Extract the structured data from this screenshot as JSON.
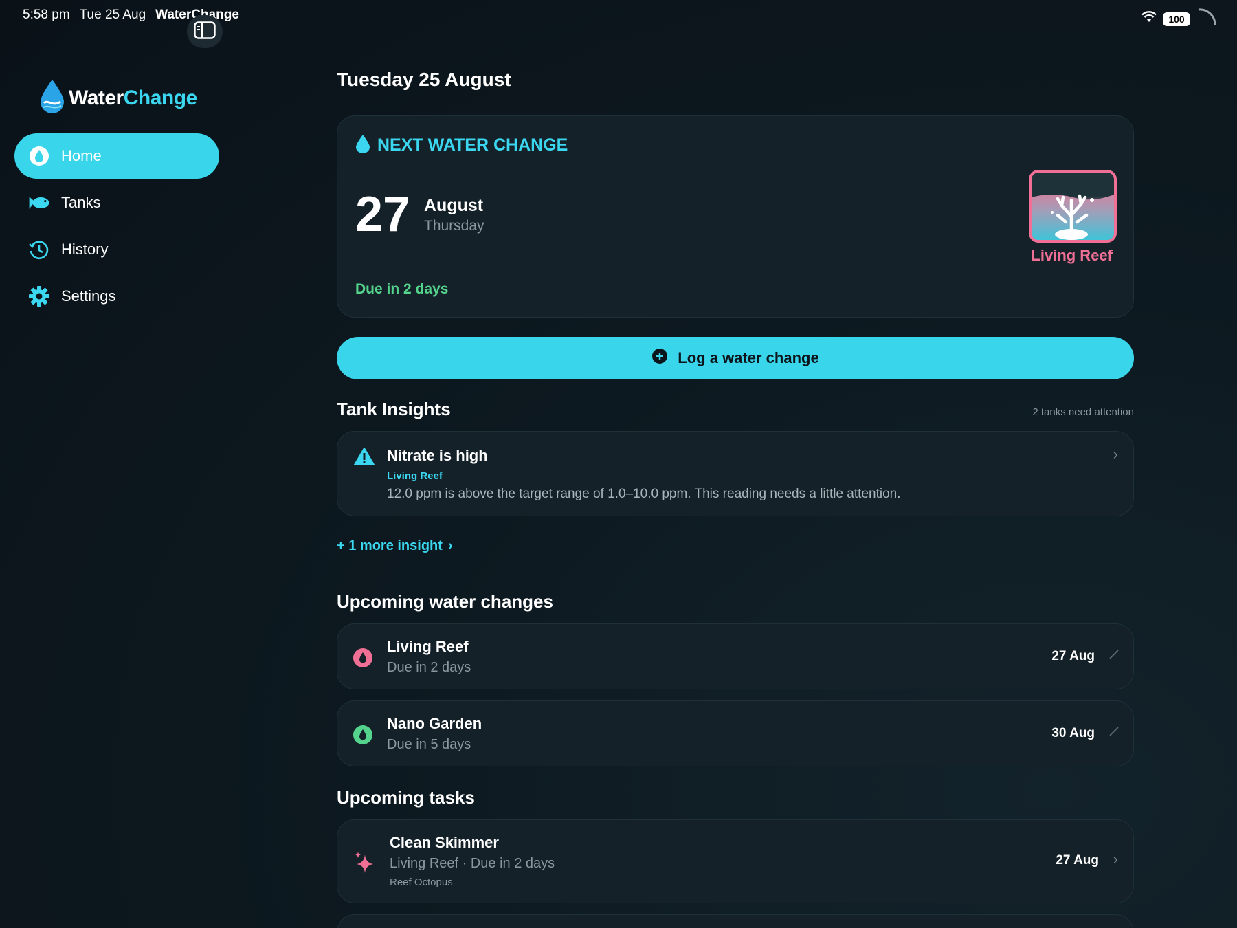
{
  "status_bar": {
    "time": "5:58 pm",
    "date": "Tue 25 Aug",
    "app_name": "WaterChange",
    "battery": "100"
  },
  "logo": {
    "part1": "Water",
    "part2": "Change"
  },
  "sidebar": {
    "items": [
      {
        "label": "Home",
        "icon": "water-drop-icon",
        "active": true
      },
      {
        "label": "Tanks",
        "icon": "fish-icon"
      },
      {
        "label": "History",
        "icon": "history-clock-icon"
      },
      {
        "label": "Settings",
        "icon": "gear-icon"
      }
    ]
  },
  "main": {
    "title": "Tuesday 25 August",
    "next_change": {
      "header": "NEXT WATER CHANGE",
      "day": "27",
      "month": "August",
      "weekday": "Thursday",
      "due_text": "Due in 2 days",
      "tank_name": "Living Reef"
    },
    "log_button": "Log a water change",
    "insights": {
      "title": "Tank Insights",
      "meta": "2 tanks need attention",
      "items": [
        {
          "title": "Nitrate is high",
          "tank": "Living Reef",
          "text": "12.0 ppm is above the target range of 1.0–10.0 ppm. This reading needs a little attention."
        }
      ],
      "more": "+ 1 more insight"
    },
    "upcoming_changes": {
      "title": "Upcoming water changes",
      "items": [
        {
          "name": "Living Reef",
          "due": "Due in 2 days",
          "date": "27 Aug",
          "color": "#ef6f95"
        },
        {
          "name": "Nano Garden",
          "due": "Due in 5 days",
          "date": "30 Aug",
          "color": "#54d38c"
        }
      ]
    },
    "upcoming_tasks": {
      "title": "Upcoming tasks",
      "items": [
        {
          "name": "Clean Skimmer",
          "sub": "Living Reef · Due in 2 days",
          "owner": "Reef Octopus",
          "date": "27 Aug"
        }
      ]
    }
  },
  "colors": {
    "accent": "#39d5ea",
    "pink": "#ef6f95",
    "green": "#54d38c",
    "background": "#0b141b",
    "card": "#142129"
  }
}
